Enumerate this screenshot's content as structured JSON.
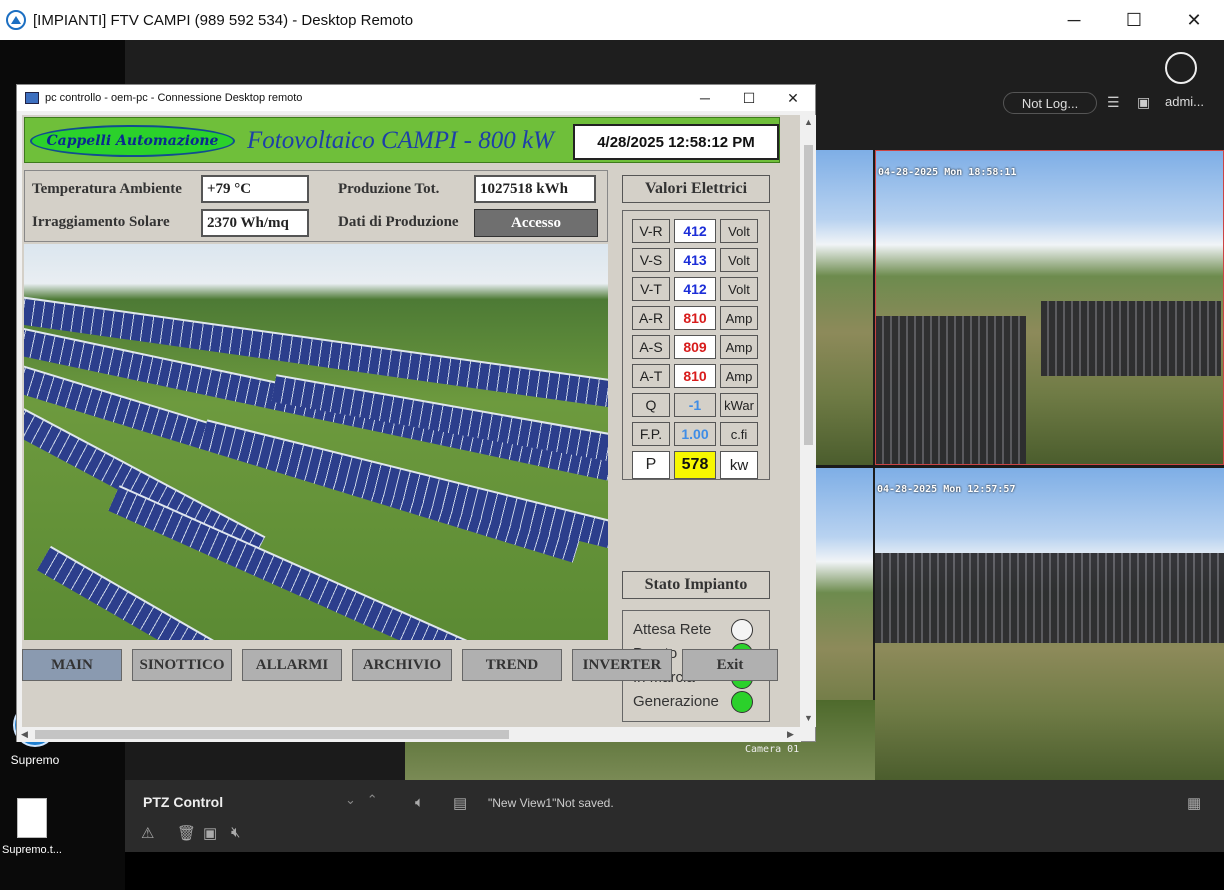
{
  "outer_window": {
    "title": "[IMPIANTI] FTV CAMPI (989 592 534) - Desktop Remoto",
    "controls": {
      "minimize": "─",
      "maximize": "☐",
      "close": "✕"
    }
  },
  "desktop": {
    "icons": [
      {
        "label": "Supremo"
      },
      {
        "label": "Supremo.t..."
      }
    ]
  },
  "nvr": {
    "not_logged": "Not Log...",
    "admin": "admi...",
    "cameras": [
      {
        "timestamp": "04-28-2025 Mon 18:58:11"
      },
      {
        "timestamp": "04-28-2025 Mon 12:57:57"
      }
    ],
    "camera_label": "Camera 01",
    "bottom": {
      "ptz_label": "PTZ Control",
      "view_status": "\"New View1\"Not saved."
    }
  },
  "rdp_window": {
    "title": "pc controllo - oem-pc - Connessione Desktop remoto",
    "controls": {
      "minimize": "─",
      "maximize": "☐",
      "close": "✕"
    }
  },
  "scada": {
    "brand": "Cappelli Automazione",
    "plant_title": "Fotovoltaico CAMPI - 800 kW",
    "clock": "4/28/2025 12:58:12 PM",
    "info": {
      "temp_label": "Temperatura Ambiente",
      "temp_value": "+79 °C",
      "irr_label": "Irraggiamento Solare",
      "irr_value": "2370 Wh/mq",
      "prod_label": "Produzione Tot.",
      "prod_value": "1027518 kWh",
      "data_label": "Dati di Produzione",
      "access_button": "Accesso"
    },
    "electrical": {
      "title": "Valori Elettrici",
      "rows": [
        {
          "name": "V-R",
          "value": "412",
          "unit": "Volt",
          "color": "blue"
        },
        {
          "name": "V-S",
          "value": "413",
          "unit": "Volt",
          "color": "blue"
        },
        {
          "name": "V-T",
          "value": "412",
          "unit": "Volt",
          "color": "blue"
        },
        {
          "name": "A-R",
          "value": "810",
          "unit": "Amp",
          "color": "red"
        },
        {
          "name": "A-S",
          "value": "809",
          "unit": "Amp",
          "color": "red"
        },
        {
          "name": "A-T",
          "value": "810",
          "unit": "Amp",
          "color": "red"
        },
        {
          "name": "Q",
          "value": "-1",
          "unit": "kWar",
          "color": "lblue"
        },
        {
          "name": "F.P.",
          "value": "1.00",
          "unit": "c.fi",
          "color": "lblue"
        },
        {
          "name": "P",
          "value": "578",
          "unit": "kw",
          "color": "yellow"
        }
      ]
    },
    "status": {
      "title": "Stato Impianto",
      "rows": [
        {
          "label": "Attesa Rete",
          "state": "off"
        },
        {
          "label": "Pronto",
          "state": "on"
        },
        {
          "label": "In Marcia",
          "state": "on"
        },
        {
          "label": "Generazione",
          "state": "on"
        }
      ]
    },
    "nav": [
      "MAIN",
      "SINOTTICO",
      "ALLARMI",
      "ARCHIVIO",
      "TREND",
      "INVERTER",
      "Exit"
    ]
  }
}
